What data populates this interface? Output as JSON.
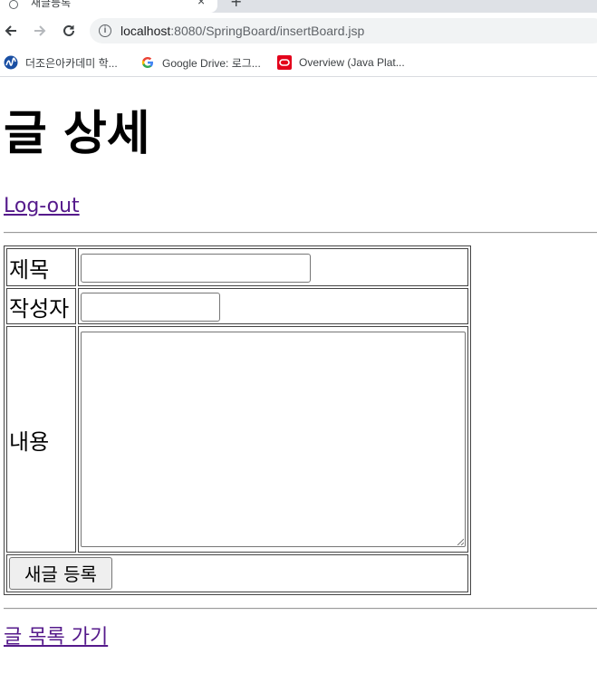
{
  "browser": {
    "tab_title": "새글등록",
    "tab_close": "×",
    "new_tab": "+",
    "url_host": "localhost",
    "url_path": ":8080/SpringBoard/insertBoard.jsp",
    "bookmarks": [
      {
        "label": "더조은아카데미 학...",
        "icon": "thejoeun-icon"
      },
      {
        "label": "Google Drive: 로그...",
        "icon": "google-icon"
      },
      {
        "label": "Overview (Java Plat...",
        "icon": "oracle-icon"
      }
    ]
  },
  "page": {
    "title": "글 상세",
    "logout_link": "Log-out",
    "form": {
      "title_label": "제목",
      "title_value": "",
      "writer_label": "작성자",
      "writer_value": "",
      "content_label": "내용",
      "content_value": "",
      "submit_label": "새글 등록"
    },
    "list_link": "글 목록 가기"
  },
  "colors": {
    "link_visited": "#551a8b",
    "chrome_bg": "#dee1e6",
    "omnibox_bg": "#f1f3f4"
  }
}
